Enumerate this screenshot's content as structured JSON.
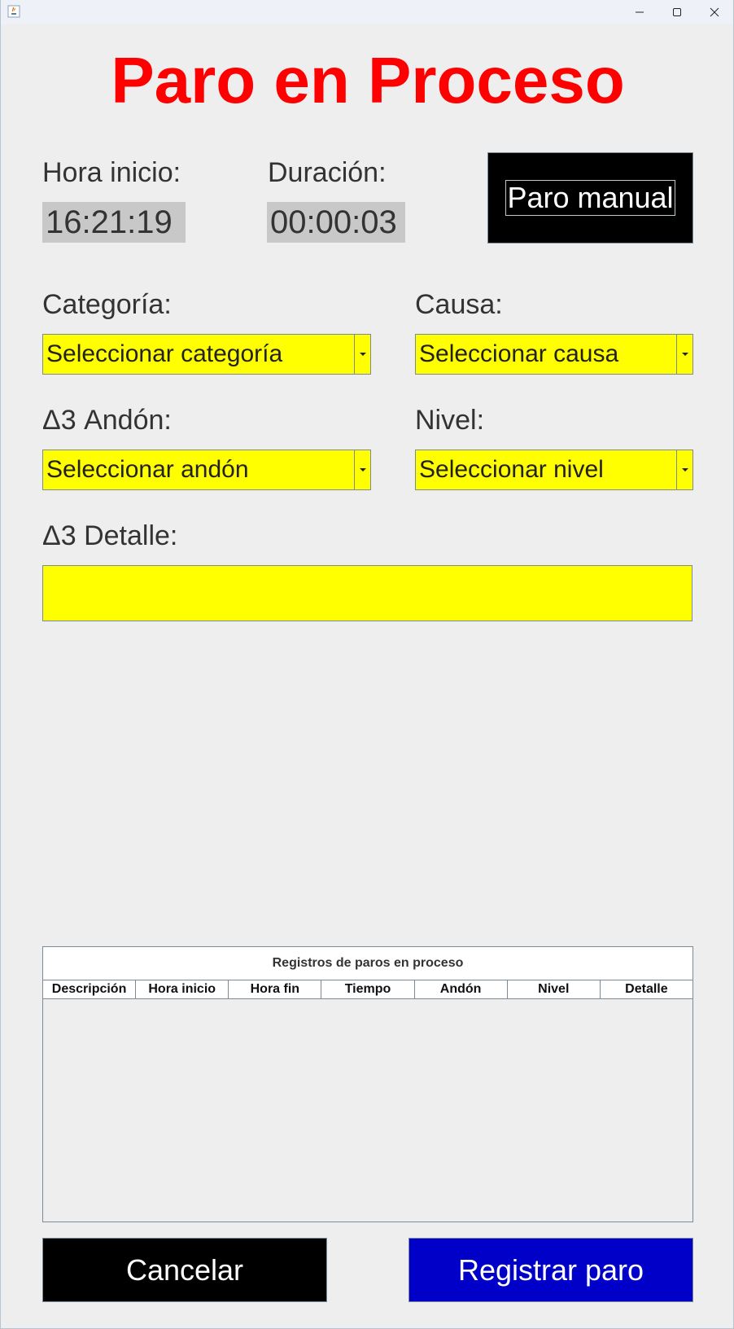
{
  "window": {
    "icon": "java-app-icon",
    "controls": [
      "minimize-icon",
      "maximize-icon",
      "close-icon"
    ]
  },
  "title": "Paro en Proceso",
  "start_time": {
    "label": "Hora inicio:",
    "value": "16:21:19"
  },
  "duration": {
    "label": "Duración:",
    "value": "00:00:03"
  },
  "manual_button": "Paro manual",
  "category": {
    "label": "Categoría:",
    "selected": "Seleccionar categoría"
  },
  "cause": {
    "label": "Causa:",
    "selected": "Seleccionar causa"
  },
  "andon": {
    "label": "Δ3 Andón:",
    "selected": "Seleccionar andón"
  },
  "level": {
    "label": "Nivel:",
    "selected": "Seleccionar nivel"
  },
  "detail": {
    "label": "Δ3 Detalle:",
    "value": ""
  },
  "table": {
    "caption": "Registros de paros en proceso",
    "columns": [
      "Descripción",
      "Hora inicio",
      "Hora fin",
      "Tiempo",
      "Andón",
      "Nivel",
      "Detalle"
    ],
    "rows": []
  },
  "buttons": {
    "cancel": "Cancelar",
    "register": "Registrar paro"
  },
  "colors": {
    "title": "#ff0000",
    "combo_background": "#ffff00",
    "manual_button": "#000000",
    "cancel_button": "#000000",
    "register_button": "#0000c8"
  }
}
